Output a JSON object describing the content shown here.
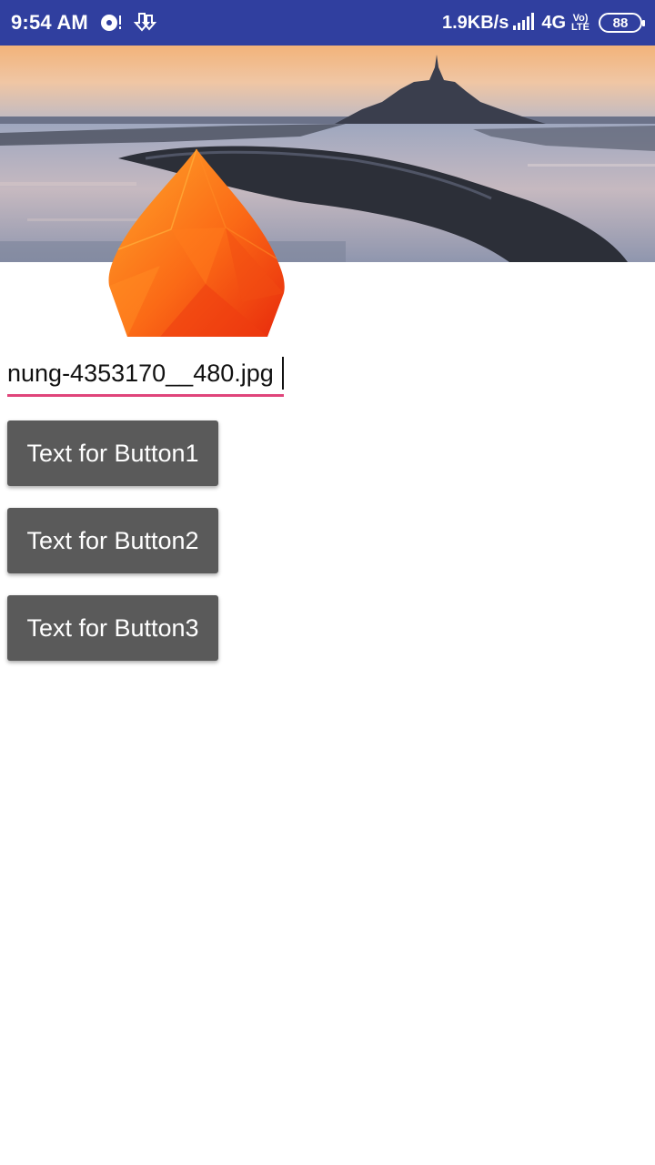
{
  "status_bar": {
    "time": "9:54 AM",
    "net_speed": "1.9KB/s",
    "network_type": "4G",
    "volte_top": "Vo)",
    "volte_bottom": "LTE",
    "battery": "88",
    "icons": [
      "media-icon",
      "download-icon",
      "signal-icon",
      "battery-icon"
    ],
    "background_color": "#303f9f"
  },
  "banner": {
    "icon": "landscape-image"
  },
  "logo": {
    "icon": "flame-logo-icon",
    "colors": [
      "#ff9a1f",
      "#f23c0e"
    ]
  },
  "edit_text": {
    "value": "nung-4353170__480.jpg",
    "underline_color": "#e0457b"
  },
  "buttons": [
    {
      "label": "Text for Button1"
    },
    {
      "label": "Text for Button2"
    },
    {
      "label": "Text for Button3"
    }
  ],
  "button_color": "#5a5a5a"
}
